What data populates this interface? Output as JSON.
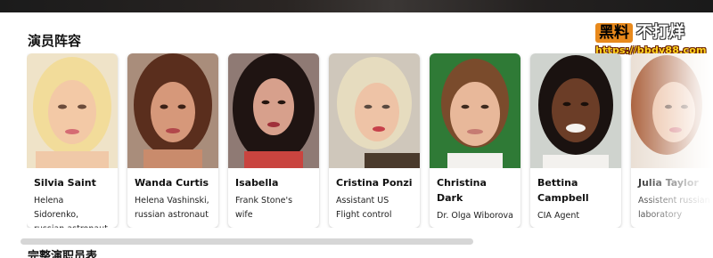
{
  "section": {
    "title": "演员阵容"
  },
  "watermark": {
    "badge": "黑料",
    "text": "不打烊",
    "url": "https://bbdy88.com"
  },
  "cast": [
    {
      "name": "Silvia Saint",
      "role": "Helena Sidorenko, russian astronaut"
    },
    {
      "name": "Wanda Curtis",
      "role": "Helena Vashinski, russian astronaut"
    },
    {
      "name": "Isabella",
      "role": "Frank Stone's wife"
    },
    {
      "name": "Cristina Ponzi",
      "role": "Assistant US Flight control"
    },
    {
      "name": "Christina Dark",
      "role": "Dr. Olga Wiborova"
    },
    {
      "name": "Bettina Campbell",
      "role": "CIA Agent"
    },
    {
      "name": "Julia Taylor",
      "role": "Assistent russian laboratory"
    }
  ],
  "full_cast": {
    "title": "完整演职员表"
  },
  "colors": {
    "watermark_badge": "#e8891c",
    "watermark_url": "#ffd21e",
    "scroll_thumb": "#d6d6d6"
  }
}
